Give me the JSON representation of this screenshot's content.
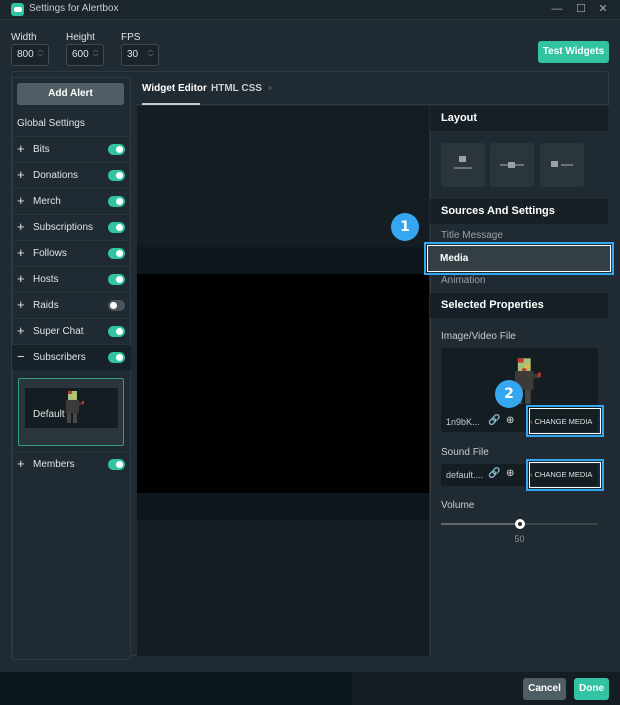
{
  "window": {
    "title": "Settings for Alertbox",
    "icon": "alertbox-app-icon",
    "controls": [
      "minimize",
      "maximize",
      "close"
    ]
  },
  "dimensions": {
    "width_label": "Width",
    "width_value": "800",
    "height_label": "Height",
    "height_value": "600",
    "fps_label": "FPS",
    "fps_value": "30"
  },
  "test_widgets_label": "Test Widgets",
  "sidebar": {
    "add_alert_label": "Add Alert",
    "global_settings_label": "Global Settings",
    "items": [
      {
        "label": "Bits",
        "expanded": false,
        "enabled": true
      },
      {
        "label": "Donations",
        "expanded": false,
        "enabled": true
      },
      {
        "label": "Merch",
        "expanded": false,
        "enabled": true
      },
      {
        "label": "Subscriptions",
        "expanded": false,
        "enabled": true
      },
      {
        "label": "Follows",
        "expanded": false,
        "enabled": true
      },
      {
        "label": "Hosts",
        "expanded": false,
        "enabled": true
      },
      {
        "label": "Raids",
        "expanded": false,
        "enabled": false
      },
      {
        "label": "Super Chat",
        "expanded": false,
        "enabled": true
      },
      {
        "label": "Subscribers",
        "expanded": true,
        "enabled": true
      },
      {
        "label": "Members",
        "expanded": false,
        "enabled": true
      }
    ],
    "variant": {
      "label": "Default"
    }
  },
  "tabs": [
    {
      "label": "Widget Editor",
      "active": true
    },
    {
      "label": "HTML CSS",
      "active": false
    }
  ],
  "right_panel": {
    "layout_title": "Layout",
    "layout_options": [
      "image-above-text",
      "image-inline-text",
      "image-left-text"
    ],
    "sources_title": "Sources And Settings",
    "sources_items": [
      "Title Message",
      "Media",
      "Animation"
    ],
    "selected_source": "Media",
    "selected_props_title": "Selected Properties",
    "image_label": "Image/Video File",
    "image_filename": "1n9bK...",
    "sound_label": "Sound File",
    "sound_filename": "default....",
    "change_media_label": "CHANGE MEDIA",
    "volume_label": "Volume",
    "volume_value": 50,
    "volume_display": "50"
  },
  "annotations": [
    {
      "number": "1",
      "target": "Media source item"
    },
    {
      "number": "2",
      "target": "Change Media buttons"
    }
  ],
  "footer": {
    "cancel_label": "Cancel",
    "done_label": "Done"
  },
  "colors": {
    "accent": "#31c3a2",
    "annotation": "#35a7f0",
    "remove": "#e5533d"
  }
}
